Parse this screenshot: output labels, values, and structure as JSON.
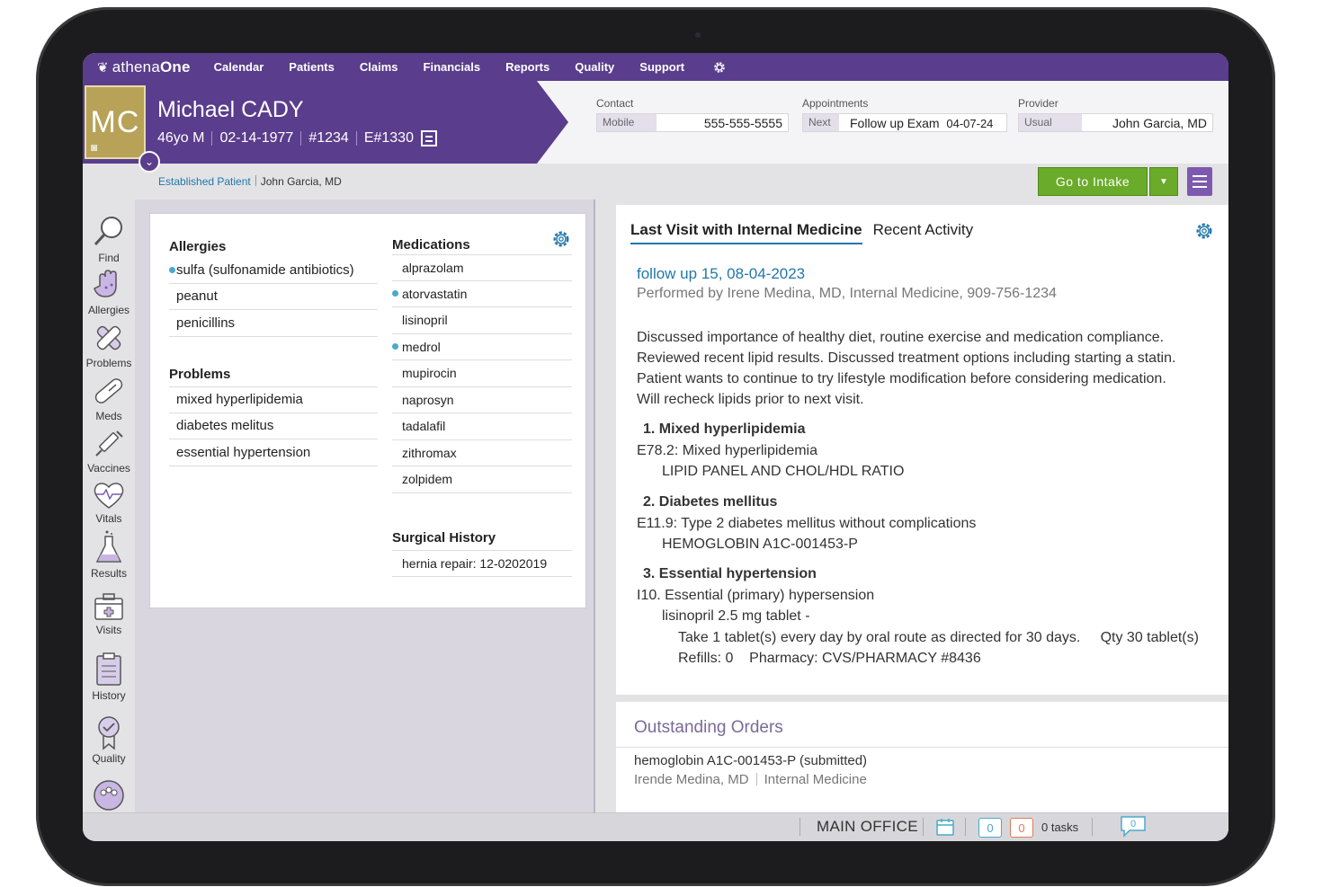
{
  "nav": {
    "brand_prefix": "athena",
    "brand_suffix": "One",
    "items": [
      "Calendar",
      "Patients",
      "Claims",
      "Financials",
      "Reports",
      "Quality",
      "Support"
    ]
  },
  "patient": {
    "initials": "MC",
    "name": "Michael CADY",
    "age_sex": "46yo M",
    "dob": "02-14-1977",
    "id": "#1234",
    "enc": "E#1330",
    "status": "Established Patient",
    "provider": "John Garcia, MD"
  },
  "contact": {
    "label": "Contact",
    "type": "Mobile",
    "value": "555-555-5555"
  },
  "appointments": {
    "label": "Appointments",
    "type": "Next",
    "value": "Follow up Exam",
    "date": "04-07-24"
  },
  "provider_box": {
    "label": "Provider",
    "type": "Usual",
    "value": "John Garcia, MD"
  },
  "intake_button": "Go to Intake",
  "sidebar": [
    "Find",
    "Allergies",
    "Problems",
    "Meds",
    "Vaccines",
    "Vitals",
    "Results",
    "Visits",
    "History",
    "Quality"
  ],
  "allergies": {
    "title": "Allergies",
    "items": [
      {
        "name": "sulfa (sulfonamide antibiotics)",
        "flag": true
      },
      {
        "name": "peanut",
        "flag": false
      },
      {
        "name": "penicillins",
        "flag": false
      }
    ]
  },
  "problems": {
    "title": "Problems",
    "items": [
      "mixed hyperlipidemia",
      "diabetes melitus",
      "essential hypertension"
    ]
  },
  "medications": {
    "title": "Medications",
    "items": [
      {
        "name": "alprazolam",
        "flag": false
      },
      {
        "name": "atorvastatin",
        "flag": true
      },
      {
        "name": "lisinopril",
        "flag": false
      },
      {
        "name": "medrol",
        "flag": true
      },
      {
        "name": "mupirocin",
        "flag": false
      },
      {
        "name": "naprosyn",
        "flag": false
      },
      {
        "name": "tadalafil",
        "flag": false
      },
      {
        "name": "zithromax",
        "flag": false
      },
      {
        "name": "zolpidem",
        "flag": false
      }
    ]
  },
  "surgical": {
    "title": "Surgical History",
    "items": [
      "hernia repair: 12-0202019"
    ]
  },
  "tabs": [
    "Last Visit with Internal Medicine",
    "Recent Activity"
  ],
  "visit": {
    "title": "follow up 15, 08-04-2023",
    "performed_by": "Performed by Irene Medina, MD, Internal Medicine, 909-756-1234",
    "notes": [
      "Discussed importance of healthy diet, routine exercise and medication compliance.",
      "Reviewed recent lipid results.  Discussed treatment options including starting a statin.",
      "Patient wants to continue to try lifestyle modification before considering medication.",
      "Will recheck lipids prior to next visit."
    ],
    "diagnoses": [
      {
        "heading": "1. Mixed hyperlipidemia",
        "code": "E78.2: Mixed hyperlipidemia",
        "lines": [
          "LIPID PANEL AND CHOL/HDL RATIO"
        ]
      },
      {
        "heading": "2. Diabetes mellitus",
        "code": "E11.9: Type 2 diabetes mellitus without complications",
        "lines": [
          "HEMOGLOBIN A1C-001453-P"
        ]
      },
      {
        "heading": "3. Essential hypertension",
        "code": "I10. Essential (primary) hypersension",
        "lines": [
          "lisinopril 2.5 mg tablet -"
        ],
        "sig": "Take 1 tablet(s) every day by oral route as directed for 30 days.",
        "qty": "Qty 30 tablet(s)",
        "refills": "Refills: 0",
        "pharmacy": "Pharmacy: CVS/PHARMACY #8436"
      }
    ]
  },
  "orders": {
    "title": "Outstanding Orders",
    "item": "hemoglobin  A1C-001453-P (submitted)",
    "provider": "Irende Medina, MD",
    "dept": "Internal Medicine"
  },
  "footer": {
    "office": "MAIN OFFICE",
    "count_blue": "0",
    "count_red": "0",
    "tasks": "0 tasks",
    "chat_count": "0"
  },
  "colors": {
    "brand_purple": "#5a3d8c",
    "accent_green": "#6aab2a",
    "link_blue": "#2277aa",
    "flag_dot": "#4ca8cc"
  }
}
